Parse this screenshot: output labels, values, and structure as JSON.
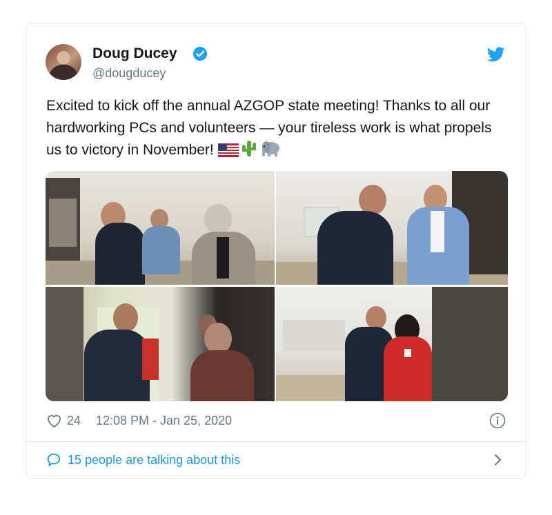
{
  "author": {
    "name": "Doug Ducey",
    "handle": "@dougducey",
    "verified": true
  },
  "tweet": {
    "text": "Excited to kick off the annual AZGOP state meeting! Thanks to all our hardworking PCs and volunteers — your tireless work is what propels us to victory in November!",
    "emojis": [
      "us-flag",
      "cactus",
      "elephant"
    ]
  },
  "media": {
    "photo_count": 4
  },
  "meta": {
    "likes": "24",
    "timestamp": "12:08 PM - Jan 25, 2020"
  },
  "conversation": {
    "label": "15 people are talking about this"
  },
  "colors": {
    "accent": "#1da1f2",
    "link": "#1b95e0",
    "secondary_text": "#657786",
    "border": "#e1e8ed"
  }
}
